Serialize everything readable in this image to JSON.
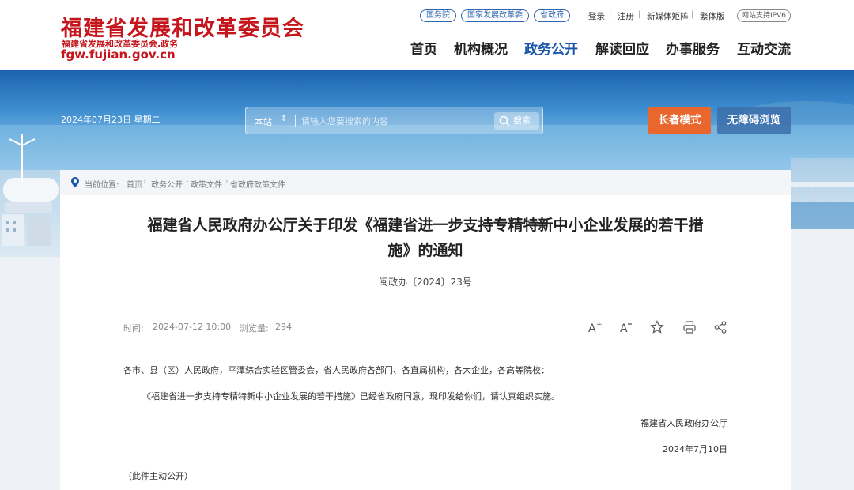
{
  "header": {
    "logo_title": "福建省发展和改革委员会",
    "logo_subtitle": "福建省发展和改革委员会.政务",
    "logo_domain": "fgw.fujian.gov.cn",
    "quick_links": [
      "国务院",
      "国家发展改革委",
      "省政府"
    ],
    "top_links": [
      "登录",
      "注册",
      "新媒体矩阵",
      "繁体版"
    ],
    "ipv6_badge": "网站支持IPV6",
    "nav": [
      {
        "label": "首页",
        "active": false
      },
      {
        "label": "机构概况",
        "active": false
      },
      {
        "label": "政务公开",
        "active": true
      },
      {
        "label": "解读回应",
        "active": false
      },
      {
        "label": "办事服务",
        "active": false
      },
      {
        "label": "互动交流",
        "active": false
      }
    ]
  },
  "banner": {
    "date": "2024年07月23日 星期二",
    "search": {
      "scope": "本站",
      "placeholder": "请输入您要搜索的内容",
      "button": "搜索"
    },
    "elder_mode": "长者模式",
    "accessible": "无障碍浏览"
  },
  "breadcrumb": {
    "label": "当前位置:",
    "items": [
      "首页",
      "政务公开",
      "政策文件",
      "省政府政策文件"
    ]
  },
  "article": {
    "title_line1": "福建省人民政府办公厅关于印发《福建省进一步支持专精特新中小企业发展的若干措",
    "title_line2": "施》的通知",
    "doc_number": "闽政办〔2024〕23号",
    "time_label": "时间:",
    "time_value": "2024-07-12 10:00",
    "views_label": "浏览量:",
    "views_value": "294",
    "recipients": "各市、县（区）人民政府，平潭综合实验区管委会，省人民政府各部门、各直属机构，各大企业，各高等院校：",
    "paragraph": "《福建省进一步支持专精特新中小企业发展的若干措施》已经省政府同意，现印发给你们，请认真组织实施。",
    "signature": "福建省人民政府办公厅",
    "sign_date": "2024年7月10日",
    "note": "（此件主动公开）"
  },
  "colors": {
    "brand_red": "#c4161c",
    "nav_active": "#1a56a8",
    "elder_orange": "#e9662c"
  }
}
